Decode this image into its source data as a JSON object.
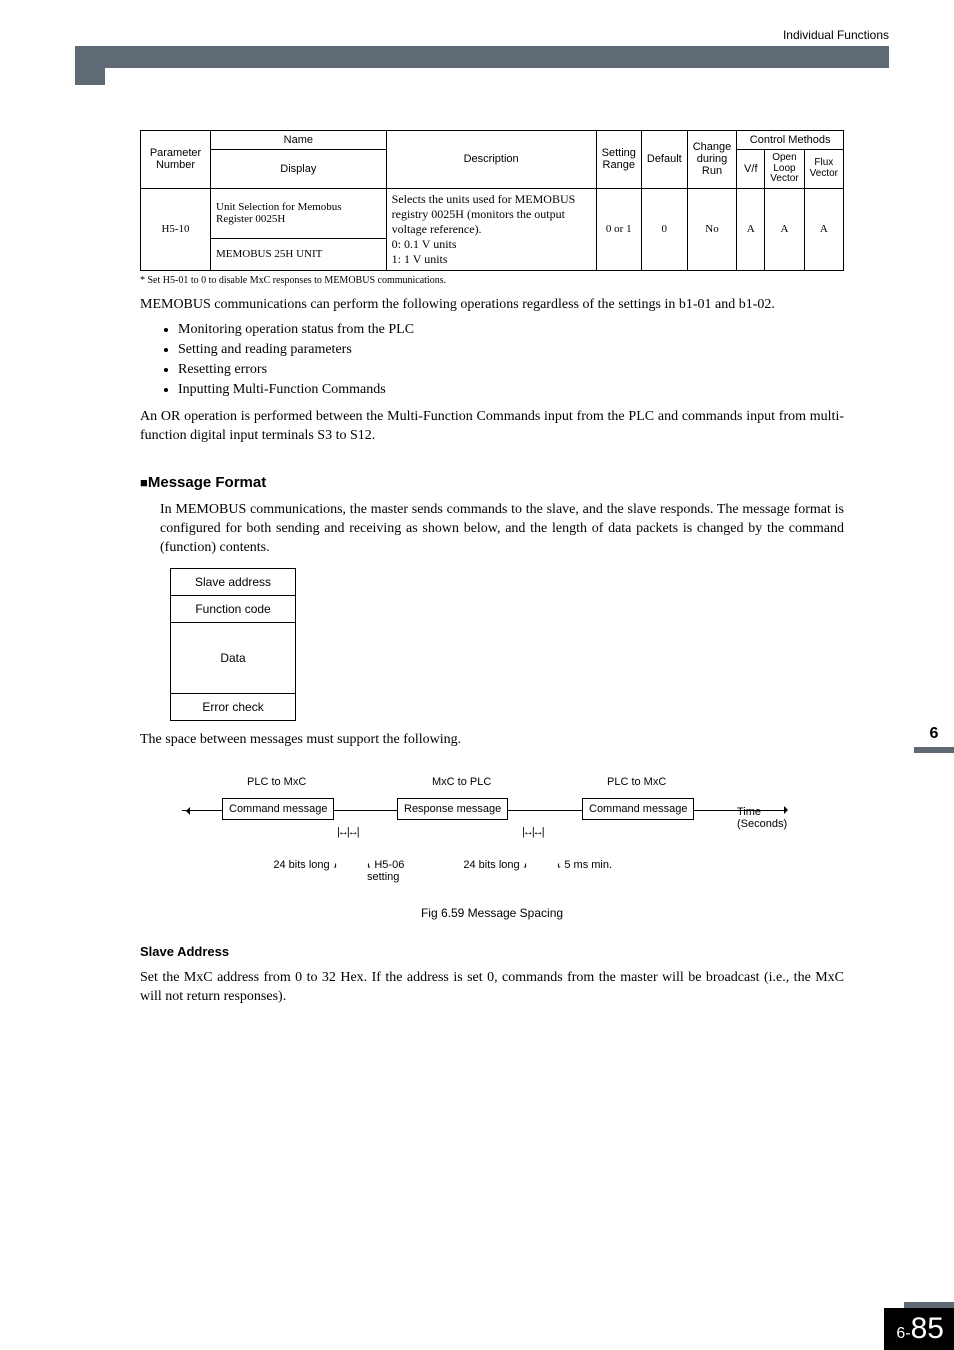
{
  "header": {
    "section_title": "Individual Functions"
  },
  "table": {
    "head": {
      "param_no": "Parameter Number",
      "name": "Name",
      "display": "Display",
      "description": "Description",
      "setting_range": "Setting Range",
      "default": "Default",
      "change_during_run": "Change during Run",
      "control_methods": "Control Methods",
      "vf": "V/f",
      "open_loop": "Open Loop Vector",
      "flux_vector": "Flux Vector"
    },
    "row": {
      "param_no": "H5-10",
      "name": "Unit Selection for Memobus Register 0025H",
      "display": "MEMOBUS 25H UNIT",
      "description_1": "Selects the units used for MEMOBUS registry 0025H (monitors the output voltage reference).",
      "description_2": "0:   0.1 V units",
      "description_3": "1:   1 V units",
      "setting_range": "0 or 1",
      "default": "0",
      "change_during_run": "No",
      "vf": "A",
      "open_loop": "A",
      "flux_vector": "A"
    }
  },
  "footnote": "*   Set H5-01 to 0 to disable MxC responses to MEMOBUS communications.",
  "body": {
    "p1": "MEMOBUS communications can perform the following operations regardless of the settings in b1-01 and b1-02.",
    "bullet1": "Monitoring operation status from the PLC",
    "bullet2": "Setting and reading parameters",
    "bullet3": "Resetting errors",
    "bullet4": "Inputting Multi-Function Commands",
    "p2": "An OR operation is performed between the Multi-Function Commands input from the PLC and commands input from multi-function digital input terminals S3 to S12."
  },
  "h3": "Message Format",
  "p3": "In MEMOBUS communications, the master sends commands to the slave, and the slave responds. The message format is configured for both sending and receiving as shown below, and the length of data packets is changed by the command (function) contents.",
  "msg_table": {
    "r1": "Slave address",
    "r2": "Function code",
    "r3": "Data",
    "r4": "Error check"
  },
  "p4": "The space between messages must support the following.",
  "diagram": {
    "top1": "PLC to MxC",
    "top2": "MxC to PLC",
    "top3": "PLC to MxC",
    "box1": "Command message",
    "box2": "Response message",
    "box3": "Command message",
    "time_label": "Time (Seconds)",
    "callout_left_a": "24 bits long",
    "callout_left_b": "H5-06 setting",
    "callout_mid": "24 bits long",
    "callout_right": "5 ms min.",
    "caption": "Fig 6.59  Message Spacing"
  },
  "h4": "Slave Address",
  "p5": "Set the MxC address from 0 to 32 Hex. If the address is set 0, commands from the master will be broadcast (i.e., the MxC will not return responses).",
  "side_tab": "6",
  "pagenum": {
    "chapter": "6-",
    "page": "85"
  },
  "chart_data": {
    "type": "table",
    "columns": [
      "Parameter Number",
      "Name",
      "Display",
      "Description",
      "Setting Range",
      "Default",
      "Change during Run",
      "V/f",
      "Open Loop Vector",
      "Flux Vector"
    ],
    "rows": [
      [
        "H5-10",
        "Unit Selection for Memobus Register 0025H",
        "MEMOBUS 25H UNIT",
        "Selects the units used for MEMOBUS registry 0025H (monitors the output voltage reference). 0: 0.1 V units  1: 1 V units",
        "0 or 1",
        "0",
        "No",
        "A",
        "A",
        "A"
      ]
    ]
  }
}
